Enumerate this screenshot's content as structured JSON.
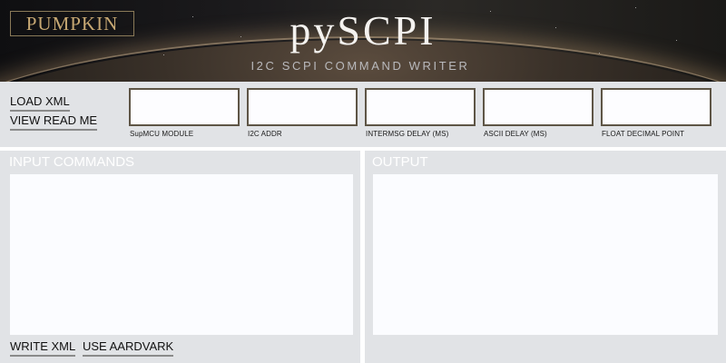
{
  "header": {
    "logo": "PUMPKIN",
    "title": "pySCPI",
    "subtitle": "I2C SCPI COMMAND WRITER"
  },
  "config": {
    "load_xml": "LOAD XML",
    "view_read_me": "VIEW READ ME",
    "fields": [
      {
        "label": "SupMCU MODULE",
        "value": ""
      },
      {
        "label": "I2C ADDR",
        "value": ""
      },
      {
        "label": "INTERMSG DELAY (MS)",
        "value": ""
      },
      {
        "label": "ASCII DELAY (MS)",
        "value": ""
      },
      {
        "label": "FLOAT DECIMAL POINT",
        "value": ""
      }
    ]
  },
  "input_panel": {
    "title": "INPUT COMMANDS",
    "value": "",
    "write_xml": "WRITE XML",
    "use_aardvark": "USE AARDVARK"
  },
  "output_panel": {
    "title": "OUTPUT",
    "value": ""
  }
}
